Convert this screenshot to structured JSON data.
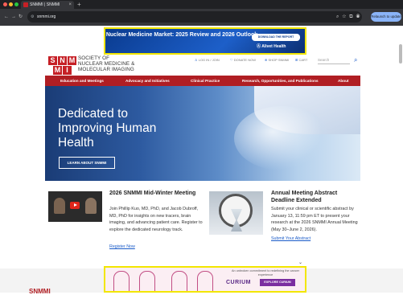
{
  "browser": {
    "tab_title": "SNMMI | SNMMI",
    "url": "snmmi.org",
    "relaunch_label": "Relaunch to update"
  },
  "top_ad": {
    "title": "Nuclear Medicine Market: 2025 Review and 2026 Outlook",
    "button": "DOWNLOAD THE REPORT",
    "brand": "Ⓐ Alivet Health"
  },
  "header": {
    "logo_letters": [
      "S",
      "N",
      "M",
      "M",
      "I"
    ],
    "logo_text": [
      "SOCIETY OF",
      "NUCLEAR MEDICINE &",
      "MOLECULAR IMAGING"
    ],
    "login": "LOG IN / JOIN",
    "donate": "DONATE NOW",
    "shop": "SHOP SNMMI",
    "cart": "CART",
    "search_placeholder": "Search"
  },
  "nav": {
    "items": [
      "Education and Meetings",
      "Advocacy and Initiatives",
      "Clinical Practice",
      "Research, Opportunities, and Publications",
      "About"
    ]
  },
  "hero": {
    "title_lines": [
      "Dedicated to",
      "Improving Human",
      "Health"
    ],
    "button": "LEARN ABOUT SNMMI"
  },
  "cards": [
    {
      "title": "2026 SNMMI Mid-Winter Meeting",
      "body": "Join Phillip Kuo, MD, PhD, and Jacob Dubroff, MD, PhD for insights on new tracers, brain imaging, and advancing patient care. Register to explore the dedicated neurology track.",
      "link": "Register Now"
    },
    {
      "title": "Annual Meeting Abstract Deadline Extended",
      "body": "Submit your clinical or scientific abstract by January 13, 11:59 pm ET to present your research at the 2026 SNMMI Annual Meeting (May 30–June 2, 2026).",
      "link": "Submit Your Abstract"
    }
  ],
  "bottom_ad": {
    "tagline": "An unbroken commitment to redefining the cancer experience",
    "brand": "CURIUM",
    "button": "EXPLORE CURIUM"
  },
  "bottom_heading": "SNMMI"
}
